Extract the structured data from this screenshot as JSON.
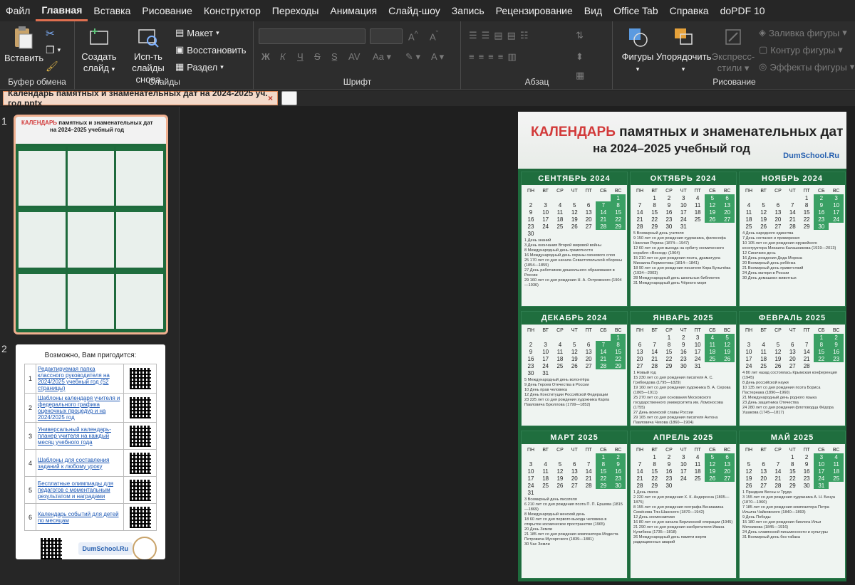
{
  "menu": [
    "Файл",
    "Главная",
    "Вставка",
    "Рисование",
    "Конструктор",
    "Переходы",
    "Анимация",
    "Слайд-шоу",
    "Запись",
    "Рецензирование",
    "Вид",
    "Office Tab",
    "Справка",
    "doPDF 10"
  ],
  "ribbon": {
    "clipboard": {
      "paste": "Вставить",
      "group": "Буфер обмена"
    },
    "slides": {
      "create": "Создать",
      "create2": "слайд",
      "reuse": "Исп-ть",
      "reuse2": "слайды снова",
      "layout": "Макет",
      "reset": "Восстановить",
      "section": "Раздел",
      "group": "Слайды"
    },
    "font": {
      "bold": "Ж",
      "italic": "К",
      "underline": "Ч",
      "strike": "S",
      "group": "Шрифт"
    },
    "paragraph": {
      "group": "Абзац"
    },
    "drawing": {
      "shapes": "Фигуры",
      "arrange": "Упорядочить",
      "styles": "Экспресс-",
      "styles2": "стили",
      "fill": "Заливка фигуры",
      "outline": "Контур фигуры",
      "effects": "Эффекты фигуры",
      "group": "Рисование"
    }
  },
  "tab": {
    "title": "Календарь памятных и знаменательных дат на 2024-2025 уч. год.pptx",
    "close": "×"
  },
  "thumbs": {
    "n1": "1",
    "n2": "2"
  },
  "slide2": {
    "heading": "Возможно, Вам пригодится:",
    "rows": [
      {
        "num": "1",
        "text": "Редактируемая папка классного руководителя на 2024/2025 учебный год (52 страницы)"
      },
      {
        "num": "2",
        "text": "Шаблоны календаря учителя и федерального графика оценочных процедур и на 2024/2025 год"
      },
      {
        "num": "3",
        "text": "Универсальный календарь-планер учителя на каждый месяц учебного года"
      },
      {
        "num": "4",
        "text": "Шаблоны для составления заданий к любому уроку"
      },
      {
        "num": "5",
        "text": "Бесплатные олимпиады для педагогов с моментальным результатом и наградами"
      },
      {
        "num": "6",
        "text": "Календарь событий для детей по месяцам"
      }
    ],
    "logo": "DumSchool.Ru"
  },
  "slide": {
    "title_red": "КАЛЕНДАРЬ",
    "title_rest": " памятных и знаменательных дат",
    "title_line2": "на 2024–2025 учебный год",
    "logo": "DumSchool.Ru",
    "weekdays": [
      "ПН",
      "ВТ",
      "СР",
      "ЧТ",
      "ПТ",
      "СБ",
      "ВС"
    ],
    "months": [
      {
        "name": "СЕНТЯБРЬ 2024",
        "events": [
          "1 День знаний",
          "3 День окончания Второй мировой войны",
          "8 Международный день грамотности",
          "16 Международный день охраны озонового слоя",
          "25 170 лет со дня начала Севастопольской обороны (1854—1855)",
          "27 День работников дошкольного образования в России",
          "29 160 лет со дня рождения Н. А. Островского (1904—1936)"
        ]
      },
      {
        "name": "ОКТЯБРЬ 2024",
        "events": [
          "5 Всемирный день учителя",
          "9 150 лет со дня рождения художника, философа Николая Рериха (1874—1947)",
          "12 60 лет со дня выхода на орбиту космического корабля «Восход» (1964)",
          "15 210 лет со дня рождения поэта, драматурга Михаила Лермонтова (1814—1841)",
          "18 90 лет со дня рождения писателя Кира Булычёва (1934—2003)",
          "28 Международный день школьных библиотек",
          "31 Международный день Чёрного моря"
        ]
      },
      {
        "name": "НОЯБРЬ 2024",
        "events": [
          "4 День народного единства",
          "7 День согласия и примирения",
          "10 105 лет со дня рождения оружейного конструктора Михаила Калашникова (1919—2013)",
          "12 Синичкин день",
          "16 День рождения Деда Мороза",
          "20 Всемирный день ребёнка",
          "21 Всемирный день приветствий",
          "24 День матери в России",
          "30 День домашних животных"
        ]
      },
      {
        "name": "ДЕКАБРЬ 2024",
        "events": [
          "5 Международный день волонтёра",
          "9 День Героев Отечества в России",
          "10 День прав человека",
          "12 День Конституции Российской Федерации",
          "23 225 лет со дня рождения художника Карла Павловича Брюллова (1799—1852)"
        ]
      },
      {
        "name": "ЯНВАРЬ 2025",
        "events": [
          "1 Новый год",
          "15 230 лет со дня рождения писателя А. С. Грибоедова (1795—1829)",
          "19 160 лет со дня рождения художника В. А. Серова (1865—1911)",
          "25 270 лет со дня основания Московского государственного университета им. Ломоносова (1755)",
          "27 День воинской славы России",
          "29 165 лет со дня рождения писателя Антона Павловича Чехова (1860—1904)"
        ]
      },
      {
        "name": "ФЕВРАЛЬ 2025",
        "events": [
          "4 80 лет назад состоялась Крымская конференция (1945)",
          "8 День российской науки",
          "10 135 лет со дня рождения поэта Бориса Пастернака (1890—1960)",
          "21 Международный день родного языка",
          "23 День защитника Отечества",
          "24 280 лет со дня рождения флотоводца Фёдора Ушакова (1745—1817)"
        ]
      },
      {
        "name": "МАРТ 2025",
        "events": [
          "3 Всемирный день писателя",
          "6 210 лет со дня рождения поэта П. П. Ершова (1815—1869)",
          "8 Международный женский день",
          "18 60 лет со дня первого выхода человека в открытое космическое пространство (1965)",
          "20 День Земли",
          "21 185 лет со дня рождения композитора Модеста Петровича Мусоргского (1839—1881)",
          "30 Час Земли"
        ]
      },
      {
        "name": "АПРЕЛЬ 2025",
        "events": [
          "1 День смеха",
          "2 220 лет со дня рождения Х. К. Андерсена (1805—1875)",
          "8 155 лет со дня рождения географа Вениамина Семёнова Тян-Шанского (1870—1942)",
          "12 День космонавтики",
          "16 80 лет со дня начала Берлинской операции (1945)",
          "21 290 лет со дня рождения изобретателя Ивана Кулибина (1735—1818)",
          "26 Международный день памяти жертв радиационных аварий"
        ]
      },
      {
        "name": "МАЙ 2025",
        "events": [
          "1 Праздник Весны и Труда",
          "3 155 лет со дня рождения художника А. Н. Бенуа (1870—1960)",
          "7 185 лет со дня рождения композитора Петра Ильича Чайковского (1840—1893)",
          "9 День Победы",
          "15 180 лет со дня рождения биолога Ильи Мечникова (1845—1916)",
          "24 День славянской письменности и культуры",
          "31 Всемирный день без табака"
        ]
      }
    ]
  }
}
